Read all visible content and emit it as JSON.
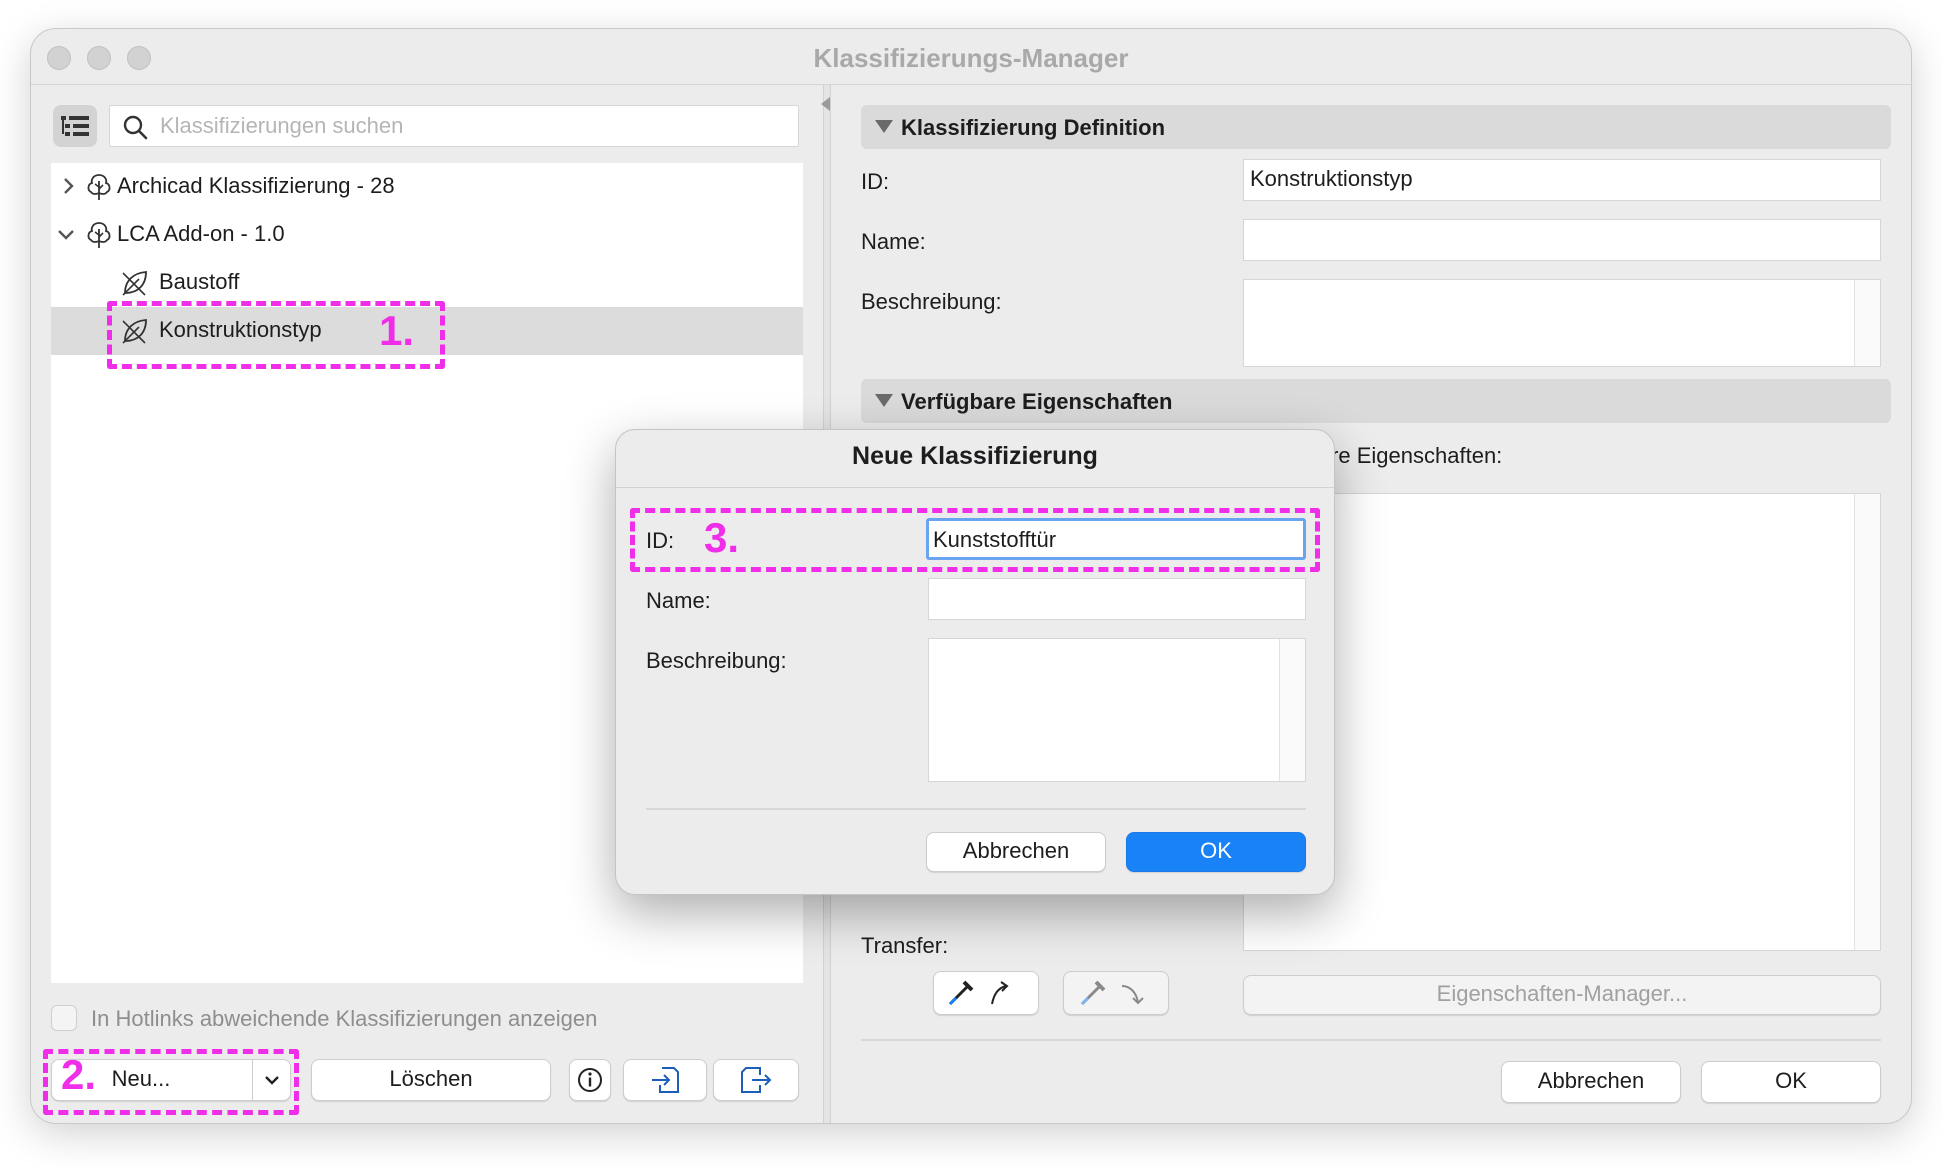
{
  "window": {
    "title": "Klassifizierungs-Manager"
  },
  "left": {
    "search_placeholder": "Klassifizierungen suchen",
    "tree": [
      {
        "label": "Archicad Klassifizierung - 28",
        "icon": "tree-icon",
        "expanded": false
      },
      {
        "label": "LCA Add-on - 1.0",
        "icon": "tree-icon",
        "expanded": true
      },
      {
        "label": "Baustoff",
        "icon": "leaf-icon"
      },
      {
        "label": "Konstruktionstyp",
        "icon": "leaf-icon",
        "selected": true
      }
    ],
    "hotlinks_label": "In Hotlinks abweichende Klassifizierungen anzeigen",
    "new_button": "Neu...",
    "delete_button": "Löschen"
  },
  "right": {
    "definition_header": "Klassifizierung Definition",
    "id_label": "ID:",
    "id_value": "Konstruktionstyp",
    "name_label": "Name:",
    "desc_label": "Beschreibung:",
    "props_header": "Verfügbare Eigenschaften",
    "props_label": "Verfügbare Eigenschaften:",
    "transfer_label": "Transfer:",
    "props_manager_button": "Eigenschaften-Manager...",
    "cancel_button": "Abbrechen",
    "ok_button": "OK"
  },
  "modal": {
    "title": "Neue Klassifizierung",
    "id_label": "ID:",
    "id_value": "Kunststofftür",
    "name_label": "Name:",
    "desc_label": "Beschreibung:",
    "cancel_button": "Abbrechen",
    "ok_button": "OK"
  },
  "annotations": [
    "1.",
    "2.",
    "3."
  ],
  "colors": {
    "accent": "#1a82f7",
    "annotation": "#f02de8",
    "selection": "#dcdcdc"
  }
}
